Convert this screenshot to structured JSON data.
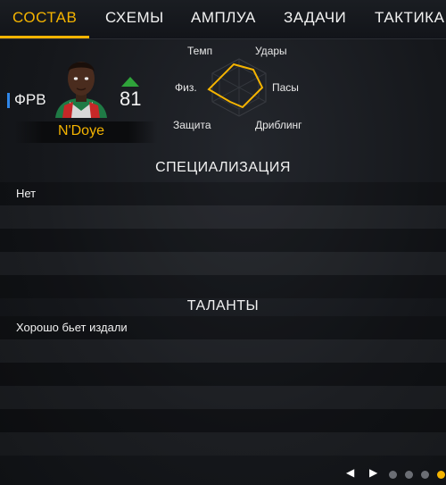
{
  "nav": {
    "tabs": [
      {
        "label": "СОСТАВ",
        "active": true
      },
      {
        "label": "СХЕМЫ",
        "active": false
      },
      {
        "label": "АМПЛУА",
        "active": false
      },
      {
        "label": "ЗАДАЧИ",
        "active": false
      },
      {
        "label": "ТАКТИКА",
        "active": false
      }
    ]
  },
  "player": {
    "position": "ФРВ",
    "rating": "81",
    "name": "N'Doye",
    "trend_icon": "up-arrow-icon"
  },
  "radar": {
    "labels": {
      "pace": "Темп",
      "shooting": "Удары",
      "passing": "Пасы",
      "dribbling": "Дриблинг",
      "defending": "Защита",
      "physical": "Физ."
    }
  },
  "specialization": {
    "title": "СПЕЦИАЛИЗАЦИЯ",
    "items": [
      "Нет"
    ]
  },
  "traits": {
    "title": "ТАЛАНТЫ",
    "items": [
      "Хорошо бьет издали"
    ]
  },
  "pager": {
    "prev_icon": "chevron-left-icon",
    "next_icon": "chevron-right-icon",
    "page_count": 4,
    "active_page": 4
  },
  "colors": {
    "accent": "#f5b400",
    "position_marker": "#2f86e8",
    "trend_up": "#2fa33a"
  }
}
